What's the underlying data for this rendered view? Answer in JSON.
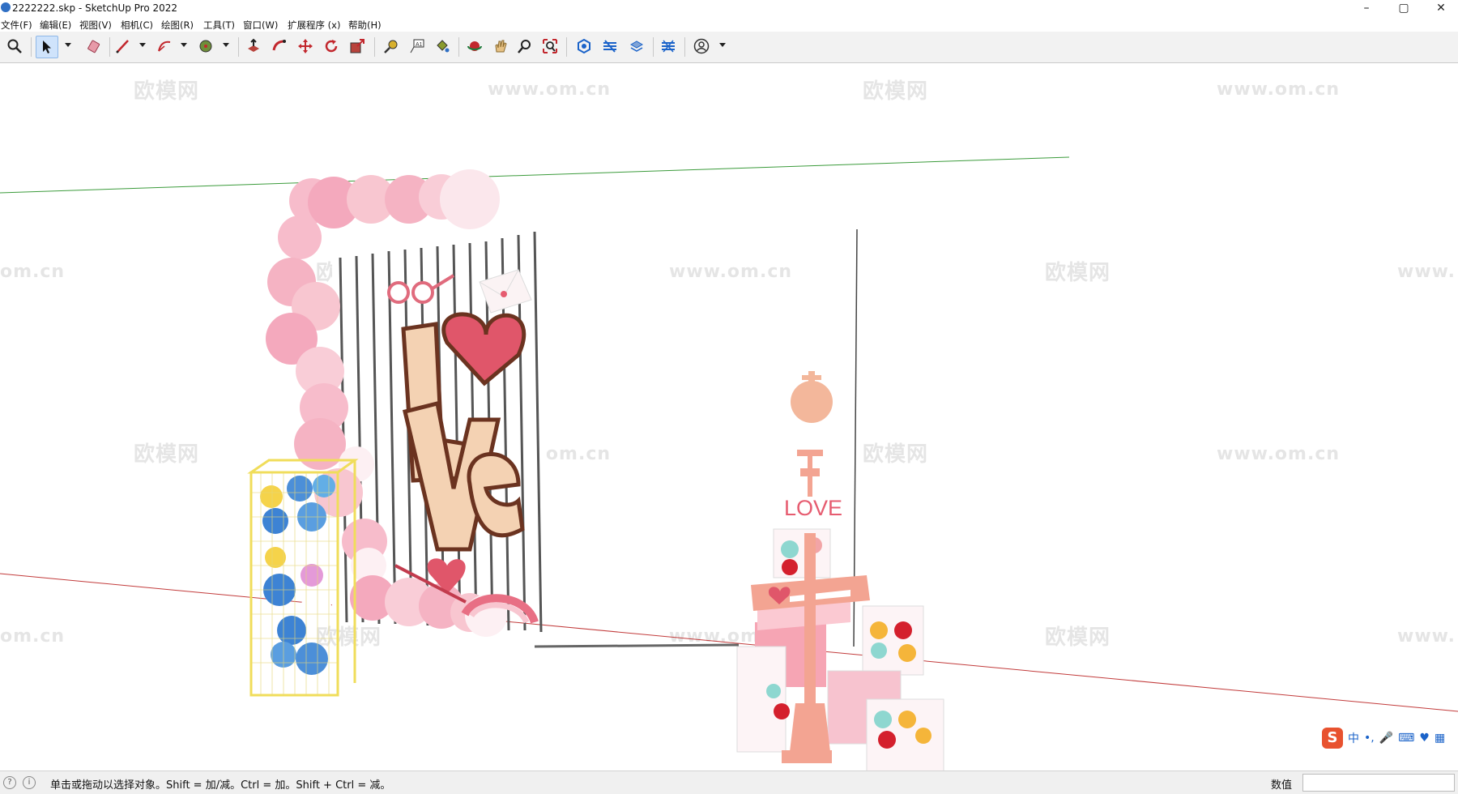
{
  "window": {
    "title": "2222222.skp - SketchUp Pro 2022",
    "controls": {
      "minimize": "–",
      "maximize": "▢",
      "close": "✕"
    }
  },
  "menu": {
    "items": [
      {
        "label": "文件(F)"
      },
      {
        "label": "编辑(E)"
      },
      {
        "label": "视图(V)"
      },
      {
        "label": "相机(C)"
      },
      {
        "label": "绘图(R)"
      },
      {
        "label": "工具(T)"
      },
      {
        "label": "窗口(W)"
      },
      {
        "label": "扩展程序 (x)"
      },
      {
        "label": "帮助(H)"
      }
    ]
  },
  "toolbar": {
    "tools": [
      "zoom-icon",
      "select-icon",
      "eraser-icon",
      "pencil-line-icon",
      "arc-icon",
      "circle-icon",
      "push-pull-icon",
      "follow-me-icon",
      "move-icon",
      "rotate-icon",
      "scale-icon",
      "tape-measure-icon",
      "text-icon",
      "paint-bucket-icon",
      "orbit-icon",
      "pan-icon",
      "zoom-window-icon",
      "zoom-extents-icon",
      "warehouse-icon",
      "extension-warehouse-icon",
      "layout-icon",
      "sandbox-icon",
      "account-icon"
    ]
  },
  "viewport": {
    "watermarks": [
      "欧模网",
      "www.om.cn",
      "om.cn",
      "www."
    ],
    "scene_text": {
      "love_sign": "LOVE",
      "love_big": "Love"
    }
  },
  "status": {
    "hint": "单击或拖动以选择对象。Shift = 加/减。Ctrl = 加。Shift + Ctrl = 减。",
    "measurements_label": "数值",
    "measurements_value": ""
  },
  "ime": {
    "logo": "S",
    "mode": "中",
    "punct": "•,",
    "icons": [
      "mic-icon",
      "keyboard-icon",
      "skin-icon",
      "grid-icon"
    ]
  },
  "colors": {
    "green_axis": "#3b9b3b",
    "red_axis": "#c23b3b",
    "toolbar_bg": "#f2f2f2",
    "balloon_pink": "#f6b7c6",
    "accent_blue": "#2f6fc4"
  }
}
